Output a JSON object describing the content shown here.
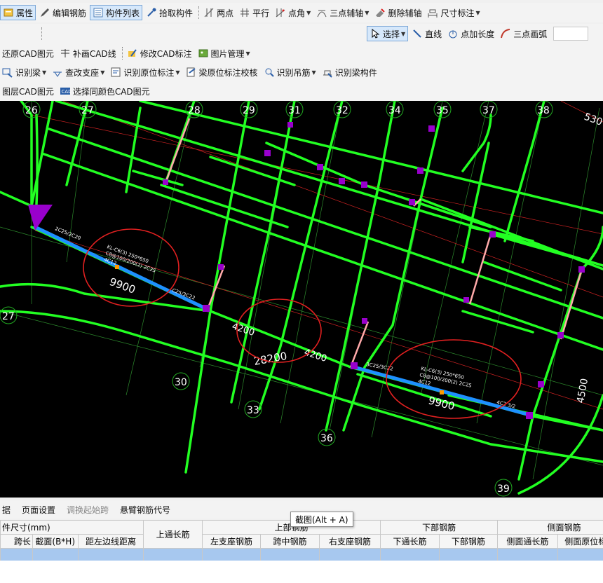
{
  "toolbar1": {
    "properties": "属性",
    "edit_rebar": "编辑钢筋",
    "component_list": "构件列表",
    "pick_component": "拾取构件",
    "two_points": "两点",
    "parallel": "平行",
    "point_angle": "点角",
    "three_point_aux": "三点辅轴",
    "delete_aux": "删除辅轴",
    "dimension": "尺寸标注"
  },
  "toolbar2": {
    "select": "选择",
    "line": "直线",
    "point_length": "点加长度",
    "three_point_arc": "三点画弧"
  },
  "toolbar3": {
    "restore_cad": "还原CAD图元",
    "patch_cad_line": "补画CAD线",
    "modify_cad_label": "修改CAD标注",
    "image_mgmt": "图片管理"
  },
  "toolbar4": {
    "identify_beam": "识别梁",
    "check_support": "查改支座",
    "identify_in_situ": "识别原位标注",
    "beam_in_situ_check": "梁原位标注校核",
    "identify_hanger": "识别吊筋",
    "identify_beam_member": "识别梁构件"
  },
  "toolbar5": {
    "layer_cad": "图层CAD图元",
    "select_same_color": "选择同颜色CAD图元"
  },
  "canvas": {
    "axis_labels": [
      "26",
      "27",
      "28",
      "29",
      "31",
      "32",
      "34",
      "35",
      "37",
      "38",
      "530",
      "27",
      "30",
      "33",
      "36",
      "39",
      "4500"
    ],
    "dims": [
      "9900",
      "4200",
      "4200",
      "28200",
      "9900"
    ],
    "beam_notes": {
      "a1": "KL-C6(3) 250*650",
      "a2": "C8@100/200(2) 2C25",
      "a3": "4C12",
      "b1": "KL-C6(3) 250*650",
      "b2": "C8@100/200(2) 2C25",
      "b3": "4C12",
      "c1": "2C25/2C20",
      "c2": "C25/3C22",
      "c3": "3C25/3C22",
      "c4": "4C2 3/2"
    },
    "colors": {
      "beam": "#22ff22",
      "selected_beam": "#1e90ff",
      "column": "#9900cc",
      "circle": "#e02020",
      "background": "#000000"
    }
  },
  "bottom_toolbar": {
    "data_prefix": "据",
    "page_setup": "页面设置",
    "adjust_start_span": "调换起始跨",
    "cantilever_code": "悬臂钢筋代号"
  },
  "tooltip": "截图(Alt + A)",
  "grid": {
    "group_size": "件尺寸(mm)",
    "top_continuous": "上通长筋",
    "top_rebar": "上部钢筋",
    "bottom_rebar": "下部钢筋",
    "side_rebar": "侧面钢筋",
    "span_length": "跨长",
    "section": "截面(B*H)",
    "dist_left": "距左边线距离",
    "left_support": "左支座钢筋",
    "mid_span": "跨中钢筋",
    "right_support": "右支座钢筋",
    "bottom_continuous": "下通长筋",
    "bottom_steel": "下部钢筋",
    "side_continuous": "侧面通长筋",
    "side_in_situ": "侧面原位标注筋"
  }
}
